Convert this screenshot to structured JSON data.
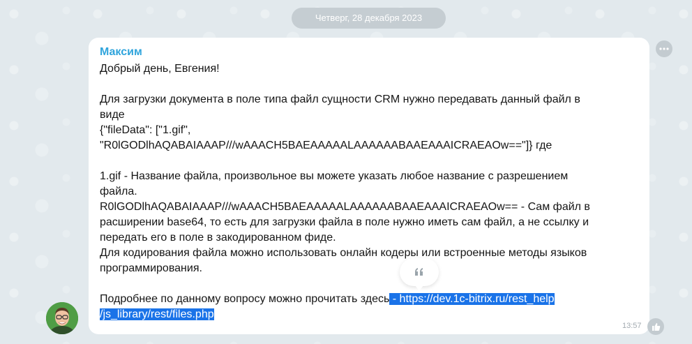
{
  "date_divider": "Четверг, 28 декабря 2023",
  "message": {
    "author": "Максим",
    "lines": {
      "greeting": "Добрый день, Евгения!",
      "p1_line1": "Для загрузки документа в поле типа файл сущности CRM нужно передавать данный файл в",
      "p1_line2": "виде",
      "p1_line3": "{\"fileData\": [\"1.gif\",",
      "p1_line4": "\"R0lGODlhAQABAIAAAP///wAAACH5BAEAAAAALAAAAAABAAEAAAICRAEAOw==\"]} где",
      "p2_line1": "1.gif - Название файла, произвольное вы можете указать любое название с разрешением",
      "p2_line2": "файла.",
      "p2_line3": "R0lGODlhAQABAIAAAP///wAAACH5BAEAAAAALAAAAAABAAEAAAICRAEAOw== - Сам файл в",
      "p2_line4": "расширении base64, то есть для загрузки файла в поле нужно иметь сам файл, а не ссылку и",
      "p2_line5": "передать его в поле в закодированном фиде.",
      "p2_line6": "Для кодирования файла можно использовать онлайн кодеры или встроенные методы языков",
      "p2_line7": "программирования.",
      "p3_prefix": "Подробнее по данному вопросу можно прочитать здесь",
      "p3_link_part1": " - https://dev.1c-bitrix.ru/rest_help",
      "p3_link_part2": "/js_library/rest/files.php"
    },
    "time": "13:57"
  },
  "icons": {
    "quote": "quote-icon",
    "more": "more-dots-icon",
    "like": "thumbs-up-icon",
    "avatar": "user-avatar"
  },
  "colors": {
    "author": "#2fa4dc",
    "selection": "#1a73e8",
    "bubble": "#ffffff",
    "background": "#e2e9ed"
  }
}
